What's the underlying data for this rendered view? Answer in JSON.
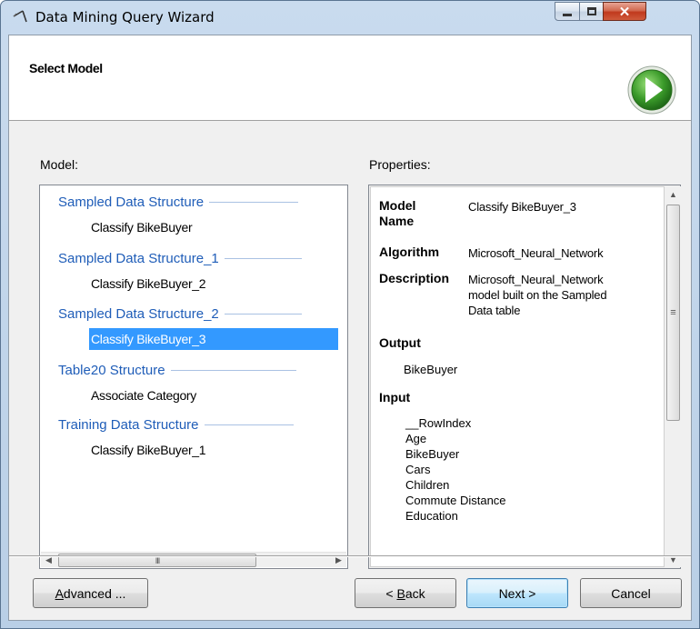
{
  "window": {
    "title": "Data Mining Query Wizard"
  },
  "header": {
    "title": "Select Model",
    "next_icon": "green-arrow-right-icon"
  },
  "labels": {
    "model": "Model:",
    "properties": "Properties:"
  },
  "models": [
    {
      "structure": "Sampled Data Structure",
      "item": "Classify BikeBuyer"
    },
    {
      "structure": "Sampled Data Structure_1",
      "item": "Classify BikeBuyer_2"
    },
    {
      "structure": "Sampled Data Structure_2",
      "item": "Classify BikeBuyer_3",
      "selected": true
    },
    {
      "structure": "Table20 Structure",
      "item": "Associate Category"
    },
    {
      "structure": "Training Data Structure",
      "item": "Classify BikeBuyer_1"
    }
  ],
  "properties": {
    "model_name_key1": "Model",
    "model_name_key2": "Name",
    "model_name_val": "Classify BikeBuyer_3",
    "algorithm_key": "Algorithm",
    "algorithm_val": "Microsoft_Neural_Network",
    "description_key": "Description",
    "description_lines": [
      "Microsoft_Neural_Network",
      "model built on the Sampled",
      "Data table"
    ],
    "output_title": "Output",
    "output_items": [
      "BikeBuyer"
    ],
    "input_title": "Input",
    "input_items": [
      "__RowIndex",
      "Age",
      "BikeBuyer",
      "Cars",
      "Children",
      "Commute Distance",
      "Education"
    ]
  },
  "buttons": {
    "advanced_accel": "A",
    "advanced_rest": "dvanced ...",
    "back_prefix": "< ",
    "back_accel": "B",
    "back_rest": "ack",
    "next": "Next >",
    "cancel": "Cancel"
  },
  "scroll_glyphs": {
    "grip_h": "III",
    "grip_v": "≡"
  }
}
